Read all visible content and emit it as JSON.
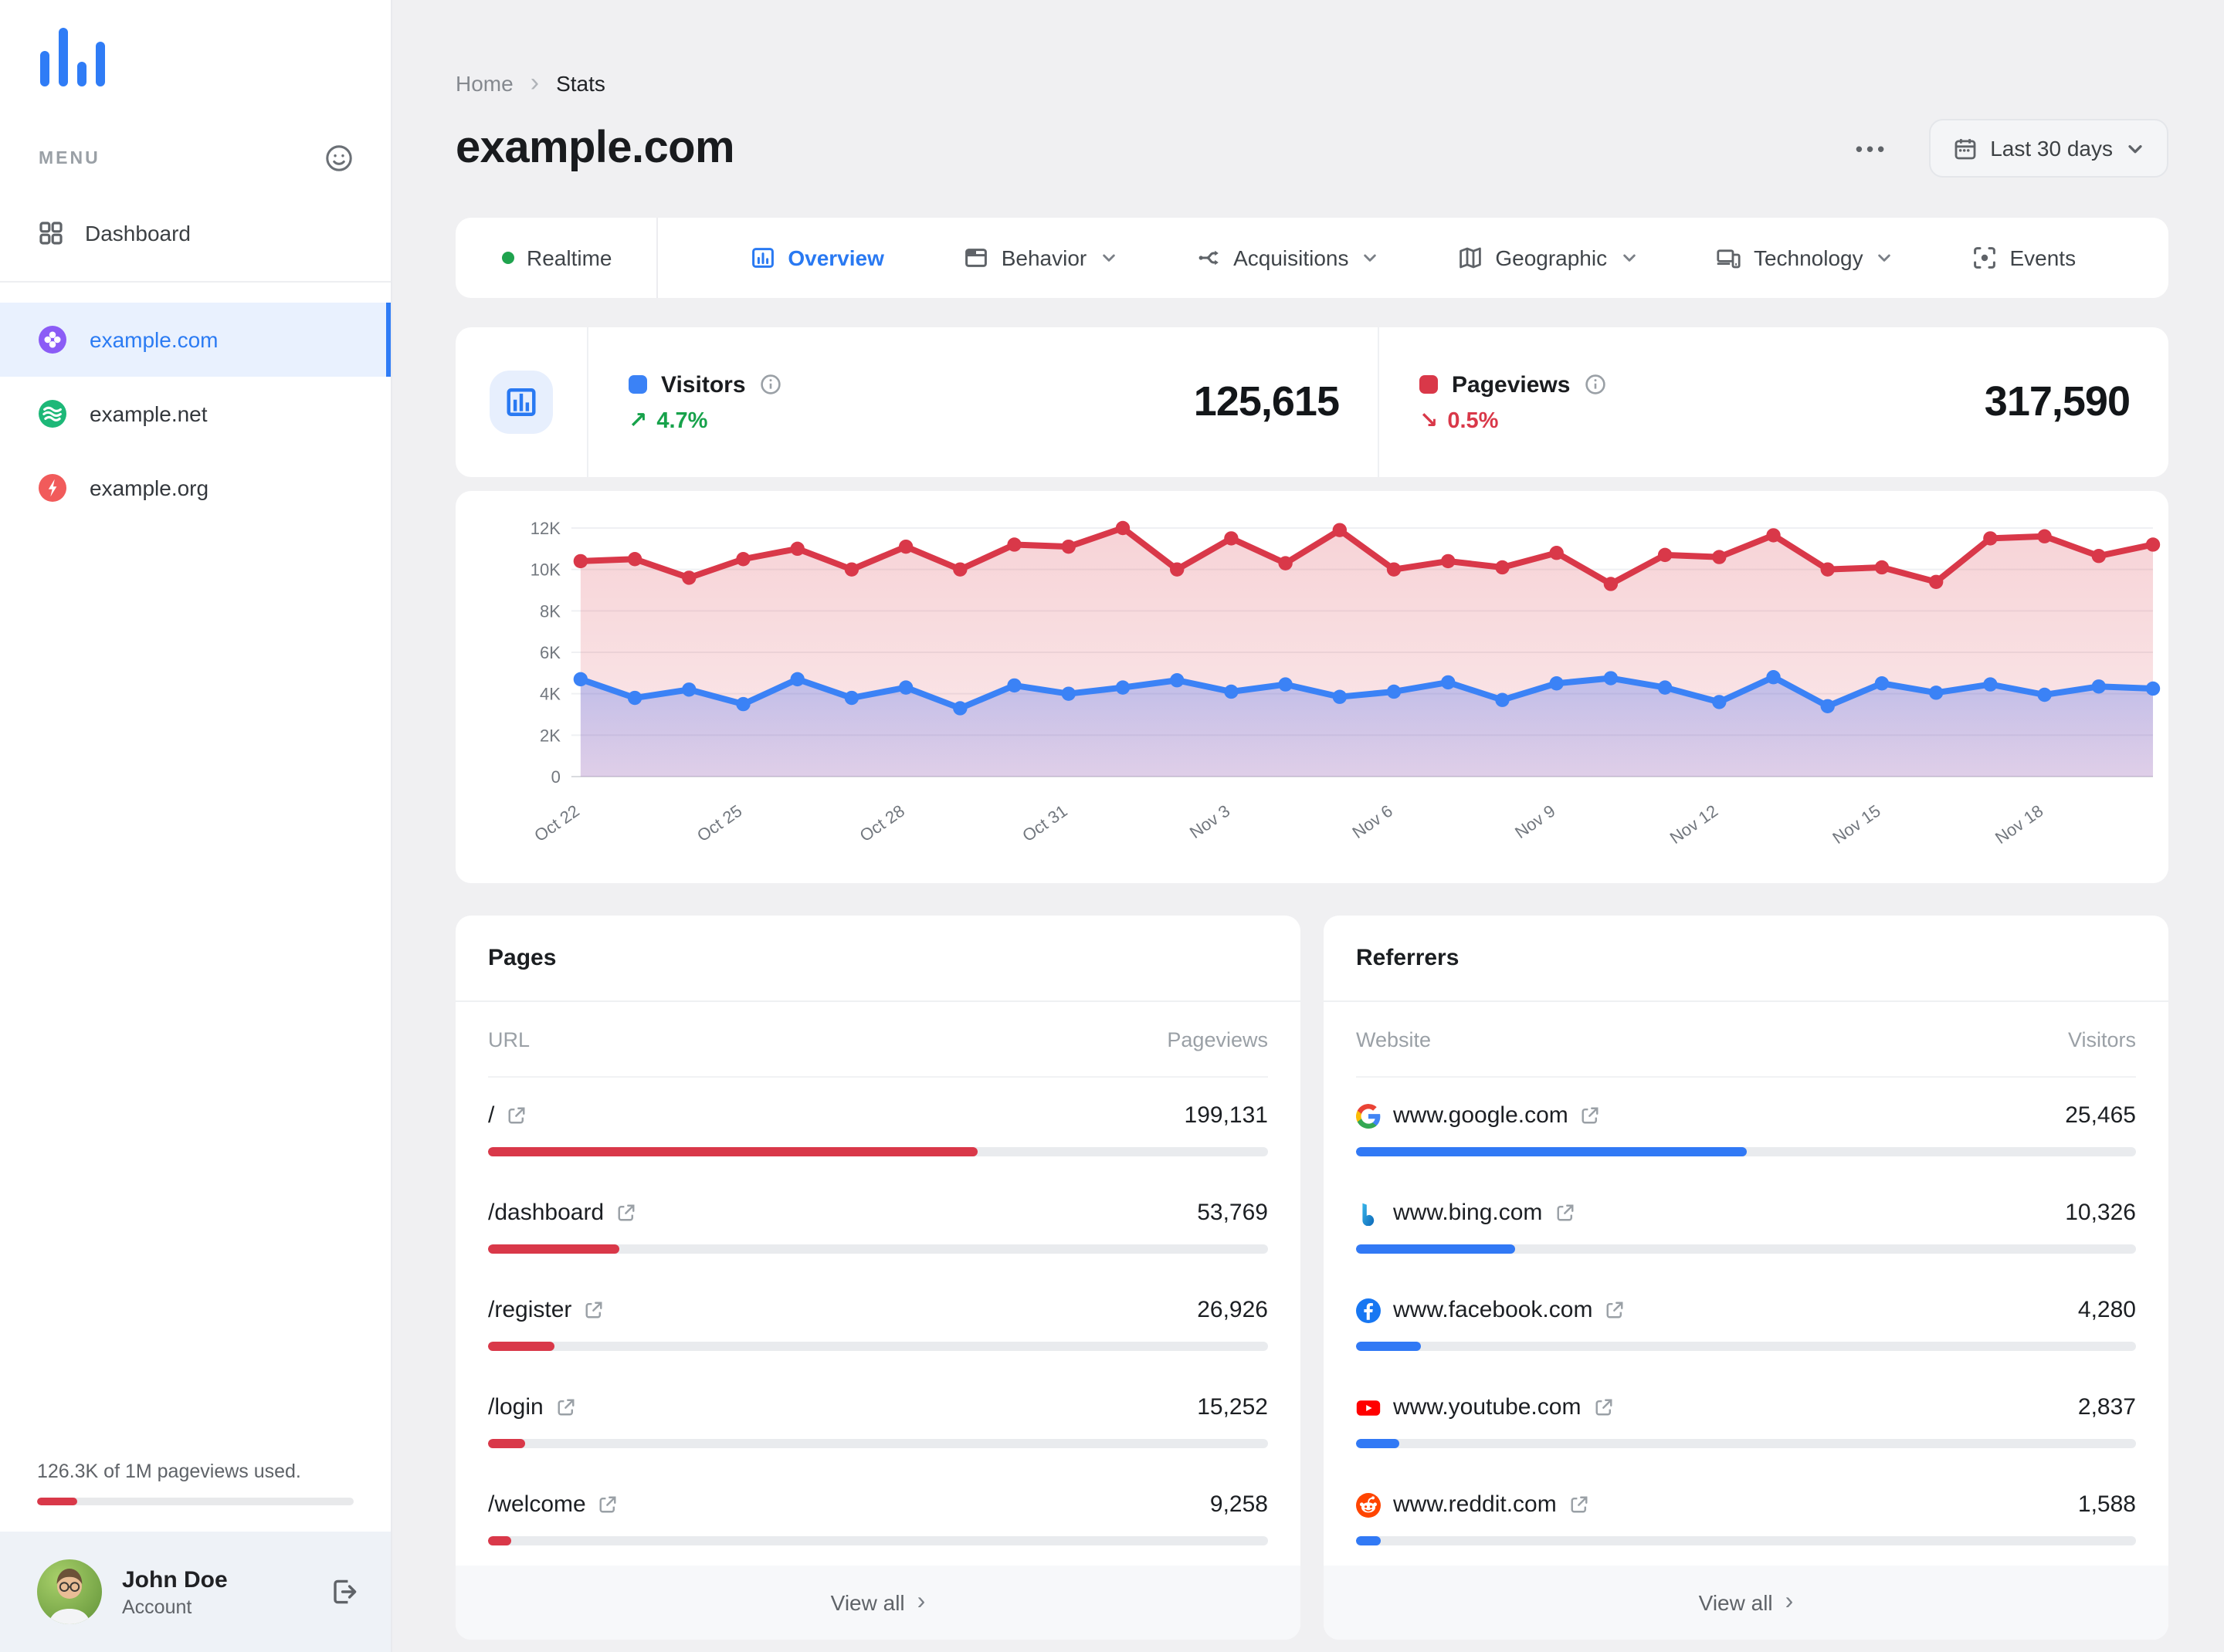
{
  "sidebar": {
    "menu_label": "MENU",
    "dashboard_label": "Dashboard",
    "sites": [
      {
        "name": "example.com",
        "active": true
      },
      {
        "name": "example.net",
        "active": false
      },
      {
        "name": "example.org",
        "active": false
      }
    ],
    "usage": {
      "text": "126.3K of 1M pageviews used.",
      "pct": 12.6
    },
    "user": {
      "name": "John Doe",
      "role": "Account"
    }
  },
  "header": {
    "breadcrumb": {
      "home": "Home",
      "current": "Stats"
    },
    "title": "example.com",
    "more": "•••",
    "date_range": "Last 30 days"
  },
  "tabs": {
    "realtime": "Realtime",
    "overview": "Overview",
    "behavior": "Behavior",
    "acquisitions": "Acquisitions",
    "geographic": "Geographic",
    "technology": "Technology",
    "events": "Events"
  },
  "stats": {
    "visitors": {
      "label": "Visitors",
      "value": "125,615",
      "arrow": "↗",
      "change": "4.7%",
      "color": "#3b82f6"
    },
    "pageviews": {
      "label": "Pageviews",
      "value": "317,590",
      "arrow": "↘",
      "change": "0.5%",
      "color": "#d93849"
    }
  },
  "chart_data": {
    "type": "line",
    "title": "Daily visitors and pageviews, last 30 days",
    "x": [
      "Oct 22",
      "Oct 23",
      "Oct 24",
      "Oct 25",
      "Oct 26",
      "Oct 27",
      "Oct 28",
      "Oct 29",
      "Oct 30",
      "Oct 31",
      "Nov 1",
      "Nov 2",
      "Nov 3",
      "Nov 4",
      "Nov 5",
      "Nov 6",
      "Nov 7",
      "Nov 8",
      "Nov 9",
      "Nov 10",
      "Nov 11",
      "Nov 12",
      "Nov 13",
      "Nov 14",
      "Nov 15",
      "Nov 16",
      "Nov 17",
      "Nov 18",
      "Nov 19",
      "Nov 20"
    ],
    "tick_every": 3,
    "ylim": [
      0,
      12000
    ],
    "yticks": [
      "0",
      "2K",
      "4K",
      "6K",
      "8K",
      "10K",
      "12K"
    ],
    "grid": true,
    "legend_position": "none",
    "series": [
      {
        "name": "Visitors",
        "color": "#3b82f6",
        "values": [
          4700,
          3800,
          4200,
          3500,
          4700,
          3800,
          4300,
          3300,
          4400,
          4000,
          4300,
          4650,
          4100,
          4450,
          3850,
          4100,
          4550,
          3700,
          4500,
          4750,
          4300,
          3600,
          4800,
          3400,
          4500,
          4050,
          4450,
          3950,
          4350,
          4250
        ]
      },
      {
        "name": "Pageviews",
        "color": "#d93849",
        "values": [
          10400,
          10500,
          9600,
          10500,
          11000,
          10000,
          11100,
          10000,
          11200,
          11100,
          12000,
          10000,
          11500,
          10300,
          11900,
          10000,
          10400,
          10100,
          10800,
          9300,
          10700,
          10600,
          11650,
          10000,
          10100,
          9400,
          11500,
          11600,
          10650,
          11200
        ]
      }
    ]
  },
  "pages": {
    "title": "Pages",
    "col_key": "URL",
    "col_value": "Pageviews",
    "view_all": "View all",
    "chevron": "›",
    "rows": [
      {
        "url": "/",
        "value": "199,131",
        "pct": 62.7
      },
      {
        "url": "/dashboard",
        "value": "53,769",
        "pct": 16.9
      },
      {
        "url": "/register",
        "value": "26,926",
        "pct": 8.5
      },
      {
        "url": "/login",
        "value": "15,252",
        "pct": 4.8
      },
      {
        "url": "/welcome",
        "value": "9,258",
        "pct": 2.9
      }
    ]
  },
  "referrers": {
    "title": "Referrers",
    "col_key": "Website",
    "col_value": "Visitors",
    "view_all": "View all",
    "chevron": "›",
    "rows": [
      {
        "site": "www.google.com",
        "value": "25,465",
        "pct": 50.0,
        "icon": "google"
      },
      {
        "site": "www.bing.com",
        "value": "10,326",
        "pct": 20.3,
        "icon": "bing"
      },
      {
        "site": "www.facebook.com",
        "value": "4,280",
        "pct": 8.4,
        "icon": "facebook"
      },
      {
        "site": "www.youtube.com",
        "value": "2,837",
        "pct": 5.6,
        "icon": "youtube"
      },
      {
        "site": "www.reddit.com",
        "value": "1,588",
        "pct": 3.1,
        "icon": "reddit"
      }
    ]
  }
}
